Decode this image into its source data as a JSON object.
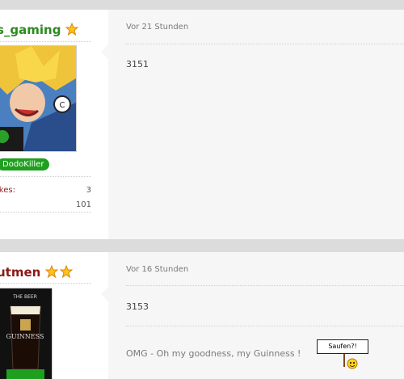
{
  "posts": [
    {
      "username": "s_gaming",
      "rank_label": "DodoKiller",
      "stats": [
        {
          "label": "ikes:",
          "value": "3"
        },
        {
          "label": "",
          "value": "101"
        }
      ],
      "time": "Vor 21 Stunden",
      "message": "3151"
    },
    {
      "username": "utmen",
      "avatar_caption": "THE BEER",
      "avatar_brand": "GUINNESS",
      "time": "Vor 16 Stunden",
      "message": "3153",
      "signature": "OMG - Oh my goodness, my Guinness !",
      "smiley_sign": "Saufen?!"
    }
  ],
  "colors": {
    "username_green": "#2d8a1e",
    "username_red": "#8a1818",
    "rank_badge": "#1ea01e",
    "content_bg": "#f6f6f6"
  }
}
